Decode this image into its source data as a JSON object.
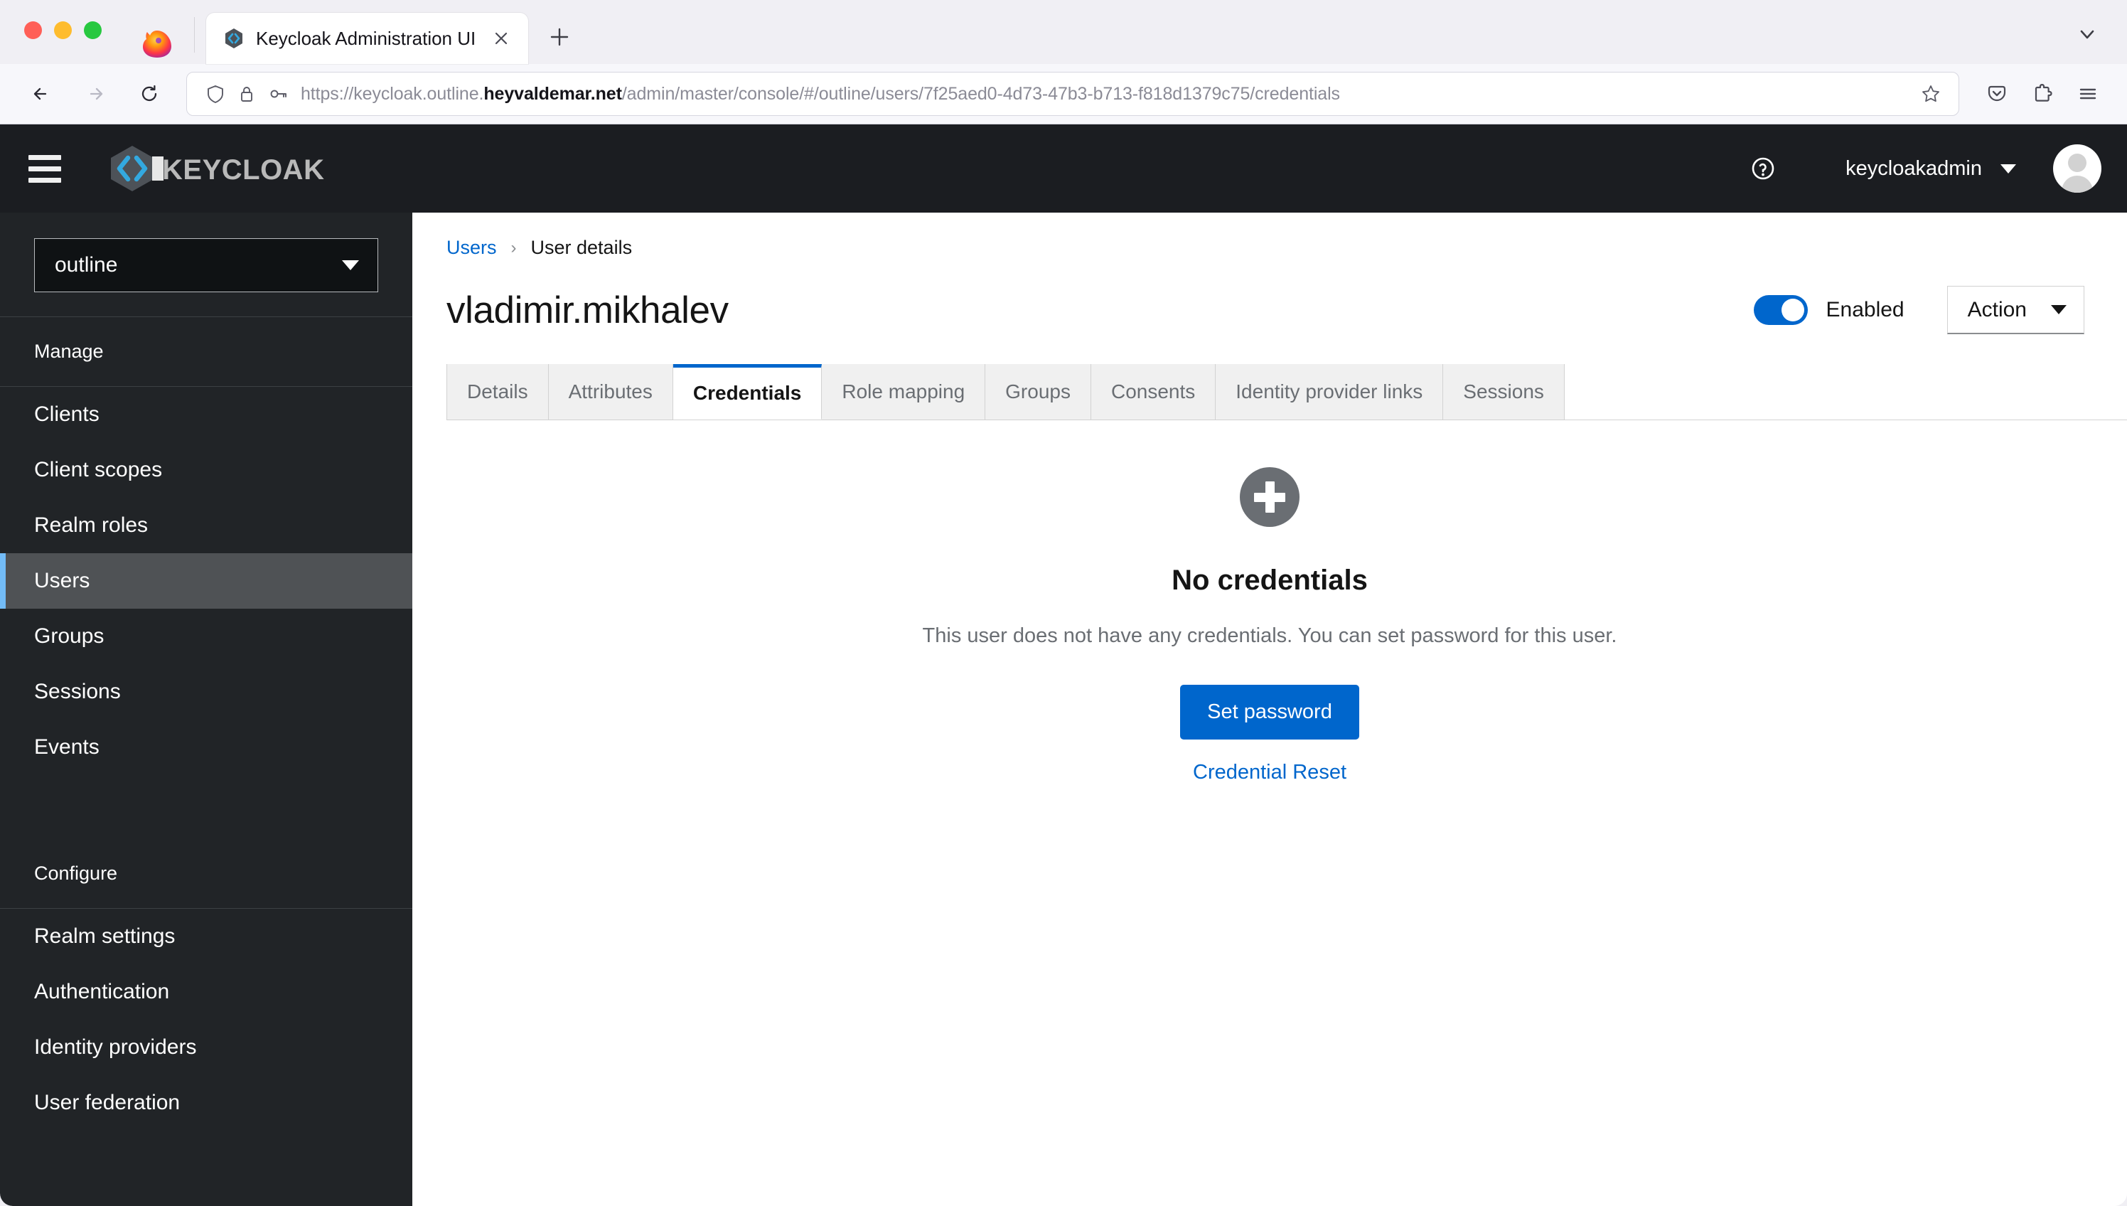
{
  "browser": {
    "tab": {
      "title": "Keycloak Administration UI",
      "favicon_icon": "keycloak-favicon",
      "close_icon": "close-icon"
    },
    "new_tab_label": "+",
    "list_all_tabs_icon": "chevron-down-icon",
    "nav": {
      "back_icon": "back-arrow-icon",
      "forward_icon": "forward-arrow-icon",
      "reload_icon": "reload-icon"
    },
    "url": {
      "shield_icon": "shield-icon",
      "lock_icon": "lock-icon",
      "key_icon": "key-icon",
      "prefix": "https://keycloak.outline.",
      "domain": "heyvaldemar.net",
      "path": "/admin/master/console/#/outline/users/7f25aed0-4d73-47b3-b713-f818d1379c75/credentials",
      "bookmark_icon": "star-icon"
    },
    "toolbar": {
      "pocket_icon": "pocket-save-icon",
      "extensions_icon": "extensions-puzzle-icon",
      "menu_icon": "app-menu-icon"
    }
  },
  "header": {
    "menu_toggle_icon": "hamburger-menu-icon",
    "brand": "KEYCLOAK",
    "help_icon": "help-question-icon",
    "username": "keycloakadmin",
    "user_caret_icon": "chevron-down-icon",
    "avatar_icon": "user-avatar-icon"
  },
  "sidebar": {
    "realm": {
      "selected": "outline",
      "caret_icon": "chevron-down-icon"
    },
    "groups": [
      {
        "title": "Manage",
        "items": [
          {
            "label": "Clients",
            "active": false
          },
          {
            "label": "Client scopes",
            "active": false
          },
          {
            "label": "Realm roles",
            "active": false
          },
          {
            "label": "Users",
            "active": true
          },
          {
            "label": "Groups",
            "active": false
          },
          {
            "label": "Sessions",
            "active": false
          },
          {
            "label": "Events",
            "active": false
          }
        ]
      },
      {
        "title": "Configure",
        "items": [
          {
            "label": "Realm settings",
            "active": false
          },
          {
            "label": "Authentication",
            "active": false
          },
          {
            "label": "Identity providers",
            "active": false
          },
          {
            "label": "User federation",
            "active": false
          }
        ]
      }
    ]
  },
  "main": {
    "breadcrumb": {
      "parent": "Users",
      "separator": "›",
      "current": "User details"
    },
    "page_title": "vladimir.mikhalev",
    "enabled": {
      "label": "Enabled",
      "on": true
    },
    "action": {
      "label": "Action",
      "caret_icon": "chevron-down-icon"
    },
    "tabs": [
      {
        "label": "Details",
        "active": false
      },
      {
        "label": "Attributes",
        "active": false
      },
      {
        "label": "Credentials",
        "active": true
      },
      {
        "label": "Role mapping",
        "active": false
      },
      {
        "label": "Groups",
        "active": false
      },
      {
        "label": "Consents",
        "active": false
      },
      {
        "label": "Identity provider links",
        "active": false
      },
      {
        "label": "Sessions",
        "active": false
      }
    ],
    "empty_state": {
      "icon": "plus-circle-icon",
      "title": "No credentials",
      "description": "This user does not have any credentials. You can set password for this user.",
      "primary_button": "Set password",
      "secondary_link": "Credential Reset"
    }
  },
  "colors": {
    "accent_blue": "#0066cc",
    "active_nav": "#73bcf7",
    "header_dark": "#1b1d21",
    "sidebar_dark": "#212427"
  }
}
